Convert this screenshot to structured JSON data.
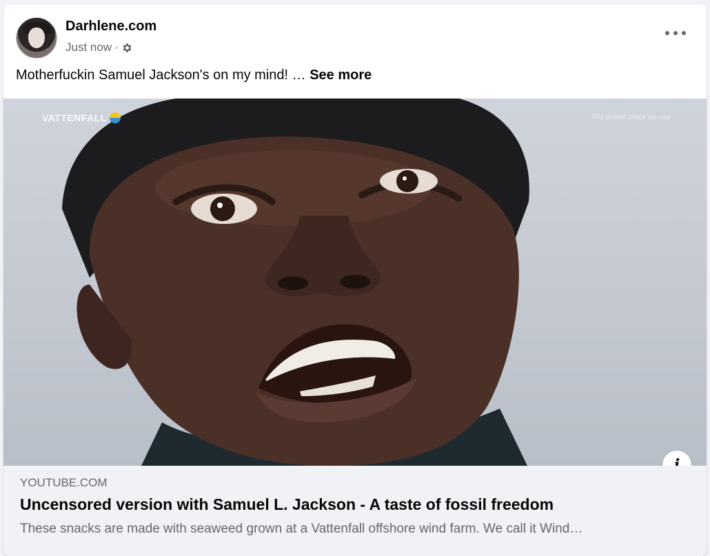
{
  "post": {
    "author": "Darhlene.com",
    "timestamp": "Just now",
    "separator": "·",
    "text": "Motherfuckin Samuel Jackson's on my mind! …",
    "see_more": "See more"
  },
  "video": {
    "brand": "VATTENFALL",
    "watermark": "The dirtiest snack we saw",
    "info_label": "i"
  },
  "link": {
    "domain": "YOUTUBE.COM",
    "title": "Uncensored version with Samuel L. Jackson - A taste of fossil freedom",
    "description": "These snacks are made with seaweed grown at a Vattenfall offshore wind farm. We call it Wind…"
  },
  "icons": {
    "privacy": "gear-icon",
    "menu": "more-options-icon",
    "info": "info-icon"
  }
}
